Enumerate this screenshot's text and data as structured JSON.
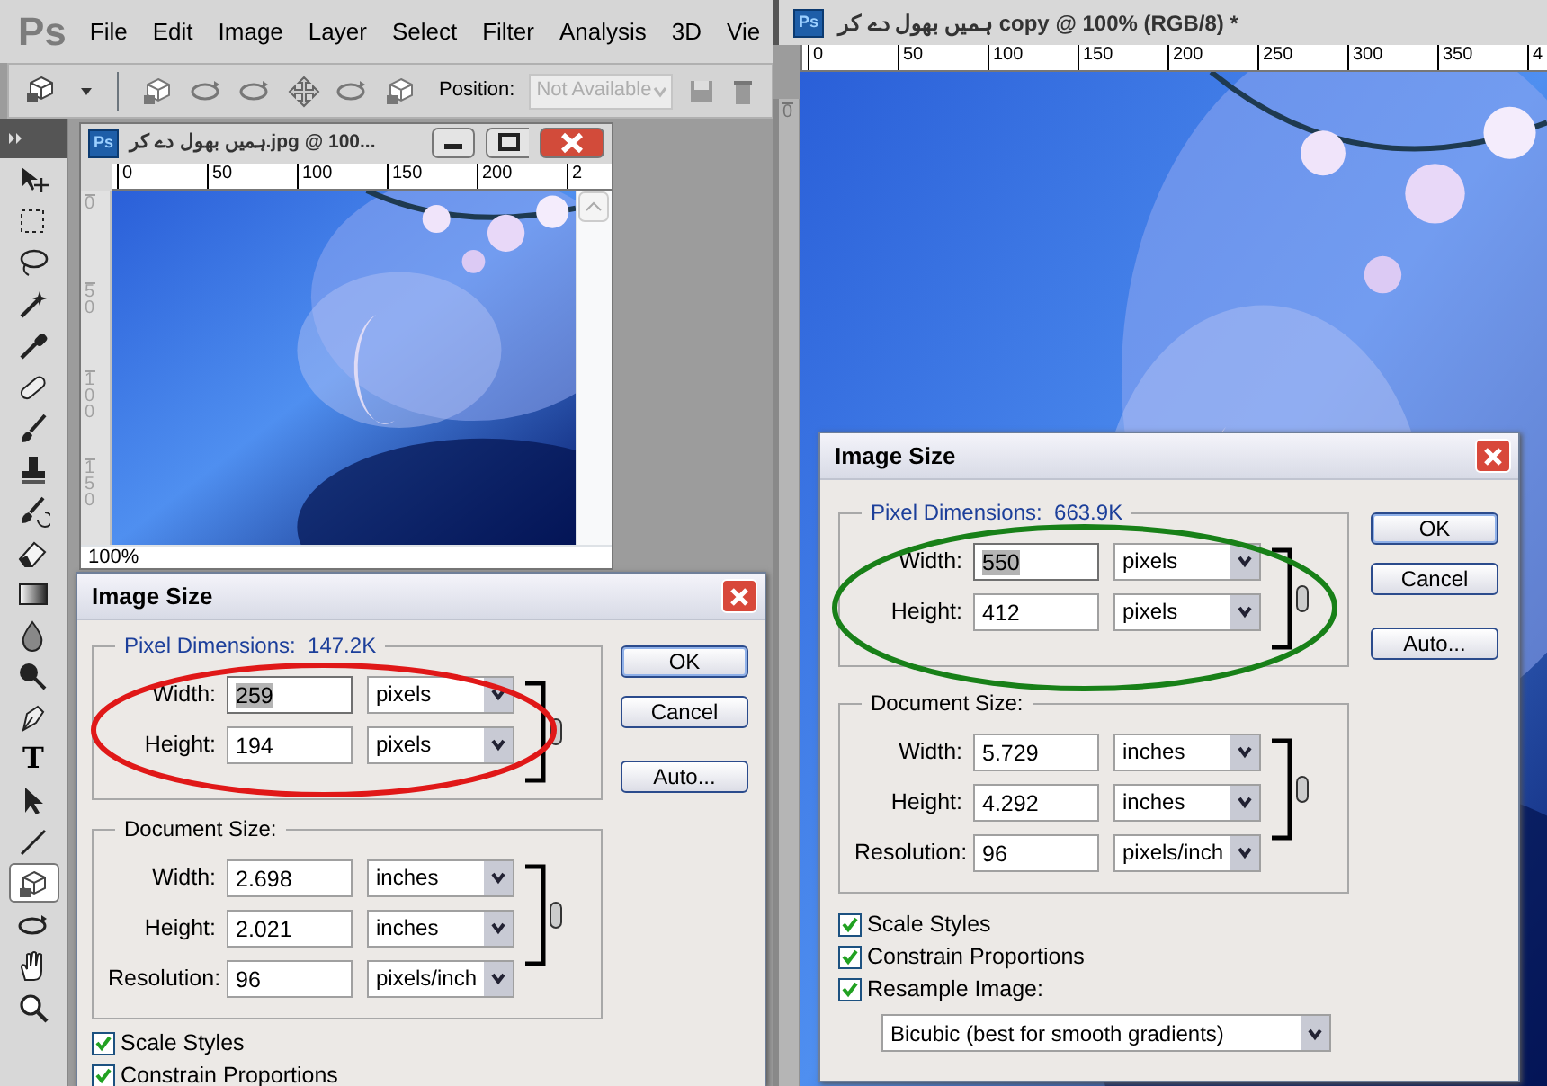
{
  "left": {
    "menu": {
      "logo": "Ps",
      "items": [
        "File",
        "Edit",
        "Image",
        "Layer",
        "Select",
        "Filter",
        "Analysis",
        "3D",
        "Vie"
      ]
    },
    "options_bar": {
      "position_label": "Position:",
      "position_select": {
        "value": "Not Available",
        "disabled": true
      }
    },
    "tools": [
      {
        "kind": "move",
        "selected": false
      },
      {
        "kind": "marquee",
        "selected": false
      },
      {
        "kind": "lasso",
        "selected": false
      },
      {
        "kind": "wand",
        "selected": false
      },
      {
        "kind": "eyedropper",
        "selected": false
      },
      {
        "kind": "healing",
        "selected": false
      },
      {
        "kind": "brush",
        "selected": false
      },
      {
        "kind": "stamp",
        "selected": false
      },
      {
        "kind": "history",
        "selected": false
      },
      {
        "kind": "eraser",
        "selected": false
      },
      {
        "kind": "gradient",
        "selected": false
      },
      {
        "kind": "drop",
        "selected": false
      },
      {
        "kind": "dodge",
        "selected": false
      },
      {
        "kind": "pen",
        "selected": false
      },
      {
        "kind": "type",
        "label": "T",
        "selected": false
      },
      {
        "kind": "pointer",
        "selected": false
      },
      {
        "kind": "line",
        "selected": false
      },
      {
        "kind": "cube",
        "selected": true
      },
      {
        "kind": "orbit",
        "selected": false
      },
      {
        "kind": "hand",
        "selected": false
      },
      {
        "kind": "zoom",
        "selected": false
      }
    ],
    "document": {
      "icon": "Ps",
      "title": "ہمیں بھول دے کر.jpg @ 100...",
      "h_ruler": [
        "0",
        "50",
        "100",
        "150",
        "200",
        "2"
      ],
      "v_ruler": [
        "0",
        "50",
        "100",
        "150"
      ],
      "zoom": "100%"
    },
    "dialog": {
      "title": "Image Size",
      "pixel_dimensions": {
        "label": "Pixel Dimensions:",
        "value": "147.2K"
      },
      "pixel_fields": [
        {
          "label": "Width:",
          "value": "259",
          "unit": "pixels",
          "selected": true
        },
        {
          "label": "Height:",
          "value": "194",
          "unit": "pixels",
          "selected": false
        }
      ],
      "document_size": {
        "label": "Document Size:"
      },
      "document_fields": [
        {
          "label": "Width:",
          "value": "2.698",
          "unit": "inches",
          "selected": false
        },
        {
          "label": "Height:",
          "value": "2.021",
          "unit": "inches",
          "selected": false
        },
        {
          "label": "Resolution:",
          "value": "96",
          "unit": "pixels/inch",
          "selected": false
        }
      ],
      "checkboxes": [
        {
          "label": "Scale Styles",
          "checked": true
        },
        {
          "label": "Constrain Proportions",
          "checked": true
        }
      ],
      "buttons": [
        "OK",
        "Cancel",
        "Auto..."
      ],
      "annotation": {
        "color": "#e01818"
      }
    }
  },
  "right": {
    "document": {
      "icon": "Ps",
      "title": "ہمیں بھول دے کر copy @ 100% (RGB/8) *",
      "h_ruler": [
        "0",
        "50",
        "100",
        "150",
        "200",
        "250",
        "300",
        "350",
        "4"
      ],
      "v_ruler": [
        "0"
      ]
    },
    "dialog": {
      "title": "Image Size",
      "pixel_dimensions": {
        "label": "Pixel Dimensions:",
        "value": "663.9K"
      },
      "pixel_fields": [
        {
          "label": "Width:",
          "value": "550",
          "unit": "pixels",
          "selected": true
        },
        {
          "label": "Height:",
          "value": "412",
          "unit": "pixels",
          "selected": false
        }
      ],
      "document_size": {
        "label": "Document Size:"
      },
      "document_fields": [
        {
          "label": "Width:",
          "value": "5.729",
          "unit": "inches",
          "selected": false
        },
        {
          "label": "Height:",
          "value": "4.292",
          "unit": "inches",
          "selected": false
        },
        {
          "label": "Resolution:",
          "value": "96",
          "unit": "pixels/inch",
          "selected": false
        }
      ],
      "checkboxes": [
        {
          "label": "Scale Styles",
          "checked": true
        },
        {
          "label": "Constrain Proportions",
          "checked": true
        },
        {
          "label": "Resample Image:",
          "checked": true
        }
      ],
      "resample": {
        "value": "Bicubic (best for smooth gradients)"
      },
      "buttons": [
        "OK",
        "Cancel",
        "Auto..."
      ],
      "annotation": {
        "color": "#188018"
      }
    }
  }
}
